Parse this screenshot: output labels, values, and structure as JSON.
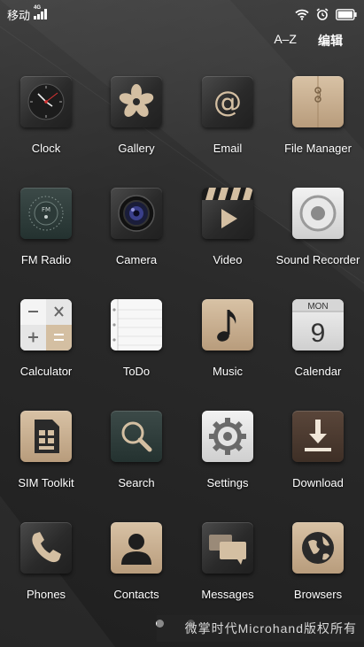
{
  "status_bar": {
    "carrier": "移动",
    "network_type": "4G",
    "icons": [
      "signal-icon",
      "wifi-icon",
      "alarm-icon",
      "battery-icon"
    ]
  },
  "top_bar": {
    "sort_label": "A–Z",
    "edit_label": "编辑"
  },
  "apps": [
    {
      "label": "Clock",
      "icon": "clock-icon"
    },
    {
      "label": "Gallery",
      "icon": "flower-icon"
    },
    {
      "label": "Email",
      "icon": "at-icon"
    },
    {
      "label": "File Manager",
      "icon": "folder-icon"
    },
    {
      "label": "FM Radio",
      "icon": "radio-icon"
    },
    {
      "label": "Camera",
      "icon": "camera-lens-icon"
    },
    {
      "label": "Video",
      "icon": "clapperboard-icon"
    },
    {
      "label": "Sound Recorder",
      "icon": "record-icon"
    },
    {
      "label": "Calculator",
      "icon": "calculator-icon"
    },
    {
      "label": "ToDo",
      "icon": "notepad-icon"
    },
    {
      "label": "Music",
      "icon": "music-note-icon"
    },
    {
      "label": "Calendar",
      "icon": "calendar-icon",
      "badge_day": "MON",
      "badge_date": "9"
    },
    {
      "label": "SIM Toolkit",
      "icon": "sim-card-icon"
    },
    {
      "label": "Search",
      "icon": "magnifier-icon"
    },
    {
      "label": "Settings",
      "icon": "gear-icon"
    },
    {
      "label": "Download",
      "icon": "download-icon"
    },
    {
      "label": "Phones",
      "icon": "phone-icon"
    },
    {
      "label": "Contacts",
      "icon": "person-icon"
    },
    {
      "label": "Messages",
      "icon": "chat-bubbles-icon"
    },
    {
      "label": "Browsers",
      "icon": "globe-icon"
    }
  ],
  "page_indicator": {
    "pages": 2,
    "active": 1
  },
  "watermark": "微掌时代Microhand版权所有",
  "colors": {
    "background": "#2a2a2a",
    "tan_accent": "#c9b08f",
    "text": "#ffffff"
  }
}
